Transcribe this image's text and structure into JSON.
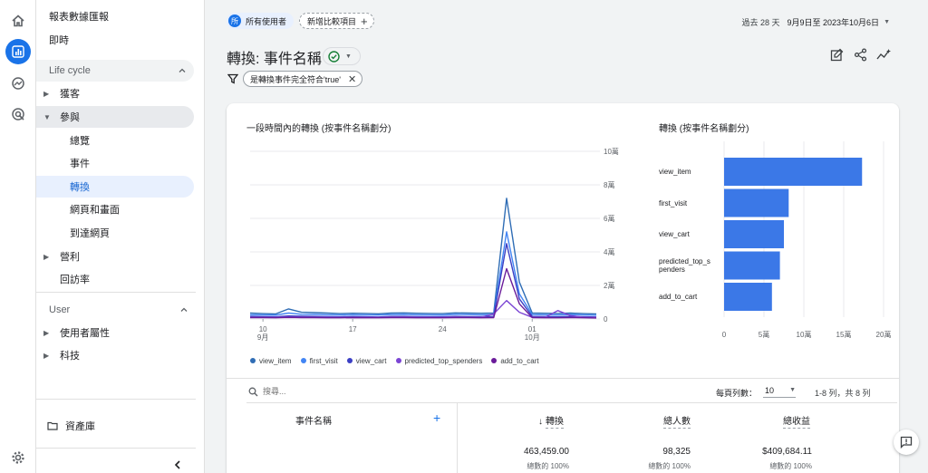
{
  "nav": {
    "report_title": "報表數據匯報",
    "realtime": "即時",
    "lifecycle": "Life cycle",
    "acquisition": "獲客",
    "engagement": "參與",
    "overview": "總覽",
    "events": "事件",
    "conversions": "轉換",
    "pages_screens": "網頁和畫面",
    "landing_page": "到達網頁",
    "monetization": "營利",
    "retention": "回訪率",
    "user": "User",
    "user_attributes": "使用者屬性",
    "tech": "科技",
    "library": "資產庫"
  },
  "header": {
    "segment_badge": "所",
    "segment_label": "所有使用者",
    "add_comparison": "新增比較項目",
    "date_prefix": "過去 28 天",
    "date_range": "9月9日至 2023年10月6日",
    "page_title": "轉換: 事件名稱",
    "filter_chip": "是轉換事件完全符合'true'"
  },
  "line_chart": {
    "title": "一段時間內的轉換 (按事件名稱劃分)",
    "y_ticks": [
      "10萬",
      "8萬",
      "6萬",
      "4萬",
      "2萬",
      "0"
    ],
    "x_ticks": [
      {
        "day": "10",
        "month": "9月"
      },
      {
        "day": "17",
        "month": ""
      },
      {
        "day": "24",
        "month": ""
      },
      {
        "day": "01",
        "month": "10月"
      }
    ]
  },
  "chart_data": [
    {
      "type": "line",
      "title": "一段時間內的轉換 (按事件名稱劃分)",
      "xlabel": "",
      "ylabel": "",
      "ylim": [
        0,
        100000
      ],
      "x": [
        "9/9",
        "9/10",
        "9/11",
        "9/12",
        "9/13",
        "9/14",
        "9/15",
        "9/16",
        "9/17",
        "9/18",
        "9/19",
        "9/20",
        "9/21",
        "9/22",
        "9/23",
        "9/24",
        "9/25",
        "9/26",
        "9/27",
        "9/28",
        "9/29",
        "9/30",
        "10/1",
        "10/2",
        "10/3",
        "10/4",
        "10/5",
        "10/6"
      ],
      "series": [
        {
          "name": "view_item",
          "color": "#2f6db5",
          "values": [
            3500,
            3200,
            3000,
            6000,
            4000,
            3800,
            3500,
            3200,
            3400,
            3300,
            3100,
            3500,
            3600,
            3400,
            3300,
            3200,
            3600,
            3500,
            3400,
            3500,
            72000,
            22000,
            3500,
            3400,
            3300,
            3500,
            3200,
            3000
          ]
        },
        {
          "name": "first_visit",
          "color": "#4285f4",
          "values": [
            2500,
            2400,
            2300,
            3500,
            2800,
            2700,
            2500,
            2400,
            2500,
            2400,
            2300,
            2600,
            2700,
            2500,
            2400,
            2300,
            2700,
            2600,
            2500,
            2600,
            52000,
            15000,
            2600,
            2500,
            2400,
            2600,
            2400,
            2200
          ]
        },
        {
          "name": "view_cart",
          "color": "#3b3fc4",
          "values": [
            1500,
            1400,
            1300,
            1800,
            1600,
            1500,
            1400,
            1300,
            1400,
            1300,
            1200,
            1500,
            1500,
            1400,
            1300,
            1300,
            1500,
            1400,
            1400,
            1500,
            45000,
            12000,
            1500,
            1400,
            1300,
            1500,
            1300,
            1200
          ]
        },
        {
          "name": "predicted_top_spenders",
          "color": "#7b45d4",
          "values": [
            1000,
            1000,
            1000,
            1200,
            1100,
            1000,
            1000,
            1000,
            1000,
            1000,
            1000,
            1100,
            1100,
            1000,
            1000,
            1000,
            1100,
            1000,
            1000,
            3000,
            11000,
            4000,
            1000,
            1000,
            5000,
            2000,
            1000,
            1000
          ]
        },
        {
          "name": "add_to_cart",
          "color": "#6a1b9a",
          "values": [
            800,
            800,
            700,
            900,
            800,
            800,
            700,
            700,
            800,
            700,
            700,
            800,
            800,
            700,
            700,
            700,
            800,
            800,
            700,
            800,
            30000,
            9000,
            800,
            700,
            700,
            800,
            700,
            600
          ]
        }
      ]
    },
    {
      "type": "bar",
      "title": "轉換 (按事件名稱劃分)",
      "categories": [
        "view_item",
        "first_visit",
        "view_cart",
        "predicted_top_spenders",
        "add_to_cart"
      ],
      "values": [
        173000,
        81000,
        75000,
        70000,
        60000
      ],
      "xlim": [
        0,
        200000
      ],
      "x_ticks": [
        "0",
        "5萬",
        "10萬",
        "15萬",
        "20萬"
      ],
      "color": "#3b78e7"
    }
  ],
  "bar_chart": {
    "title": "轉換 (按事件名稱劃分)",
    "labels": [
      "view_item",
      "first_visit",
      "view_cart",
      "predicted_top_s\npenders",
      "add_to_cart"
    ]
  },
  "table": {
    "search_placeholder": "搜尋...",
    "rows_per_page_label": "每頁列數：",
    "rows_per_page_value": "10",
    "pagination": "1-8 列，共 8 列",
    "col_event_name": "事件名稱",
    "col_conversions": "轉換",
    "col_total_users": "總人數",
    "col_total_revenue": "總收益",
    "total_conversions": "463,459.00",
    "total_users": "98,325",
    "total_revenue": "$409,684.11",
    "pct_conversions": "總數的 100%",
    "pct_users": "總數的 100%",
    "pct_revenue": "總數的 100%"
  }
}
